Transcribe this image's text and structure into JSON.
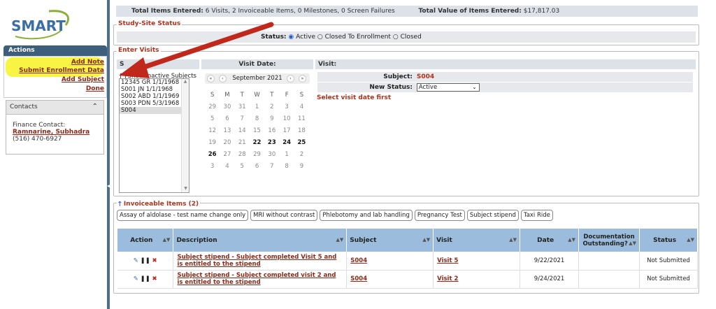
{
  "logo": {
    "text": "SMART"
  },
  "sidebar": {
    "actions_title": "Actions",
    "actions": [
      "Add Note",
      "Submit Enrollment Data",
      "Add Subject",
      "Done"
    ],
    "contacts_title": "Contacts",
    "contact_role": "Finance Contact:",
    "contact_name": "Ramnarine, Subhadra",
    "contact_phone": "(516) 470-6927"
  },
  "summary": {
    "items_label": "Total Items Entered:",
    "items_value": "6 Visits, 2 Invoiceable Items, 0 Milestones, 0 Screen Failures",
    "value_label": "Total Value of Items Entered:",
    "value_value": "$17,817.03"
  },
  "status_section": {
    "legend": "Study-Site Status",
    "label": "Status:",
    "options": [
      "Active",
      "Closed To Enrollment",
      "Closed"
    ],
    "selected": "Active"
  },
  "enter_visits": {
    "legend": "Enter Visits",
    "subject_head": "S",
    "date_head": "Visit Date:",
    "visit_head": "Visit:",
    "show_inactive": "Show Inactive Subjects",
    "subjects": [
      "12345 GR 1/1/1968",
      "S001 JN 1/1/1968",
      "S002 ABD 1/1/1969",
      "S003 PDN 5/3/1968",
      "S004"
    ],
    "selected_subject": "S004",
    "calendar": {
      "month": "September 2021",
      "prev_year": "«",
      "prev_month": "‹",
      "next_month": "›",
      "next_year": "»",
      "weekdays": [
        "S",
        "M",
        "T",
        "W",
        "T",
        "F",
        "S"
      ],
      "weeks": [
        [
          "29",
          "30",
          "31",
          "1",
          "2",
          "3",
          "4"
        ],
        [
          "5",
          "6",
          "7",
          "8",
          "9",
          "10",
          "11"
        ],
        [
          "12",
          "13",
          "14",
          "15",
          "16",
          "17",
          "18"
        ],
        [
          "19",
          "20",
          "21",
          "22",
          "23",
          "24",
          "25"
        ],
        [
          "26",
          "27",
          "28",
          "29",
          "30",
          "1",
          "2"
        ],
        [
          "3",
          "4",
          "5",
          "6",
          "7",
          "8",
          "9"
        ]
      ],
      "bold_days": [
        "22",
        "23",
        "24",
        "25",
        "26"
      ]
    },
    "subject_label": "Subject:",
    "subject_value": "S004",
    "new_status_label": "New Status:",
    "new_status_value": "Active",
    "warning": "Select visit date first"
  },
  "invoiceable": {
    "legend": "Invoiceable Items (2)",
    "chips": [
      "Assay of aldolase - test name change only",
      "MRI without contrast",
      "Phlebotomy and lab handling",
      "Pregnancy Test",
      "Subject stipend",
      "Taxi Ride"
    ],
    "columns": [
      "Action",
      "Description",
      "Subject",
      "Visit",
      "Date",
      "Documentation Outstanding?",
      "Status"
    ],
    "rows": [
      {
        "description": "Subject stipend - Subject completed Visit 5 and is entitled to the stipend",
        "subject": "S004",
        "visit": "Visit 5",
        "date": "9/22/2021",
        "doc": "",
        "status": "Not Submitted"
      },
      {
        "description": "Subject stipend - Subject completed visit 2 and is entitled to the stipend",
        "subject": "S004",
        "visit": "Visit 2",
        "date": "9/24/2021",
        "doc": "",
        "status": "Not Submitted"
      }
    ]
  },
  "colors": {
    "accent": "#b1321c",
    "link": "#8b2a1a",
    "header_blue": "#9bbcdc",
    "highlight": "#f7f33a",
    "arrow": "#c0281c"
  }
}
